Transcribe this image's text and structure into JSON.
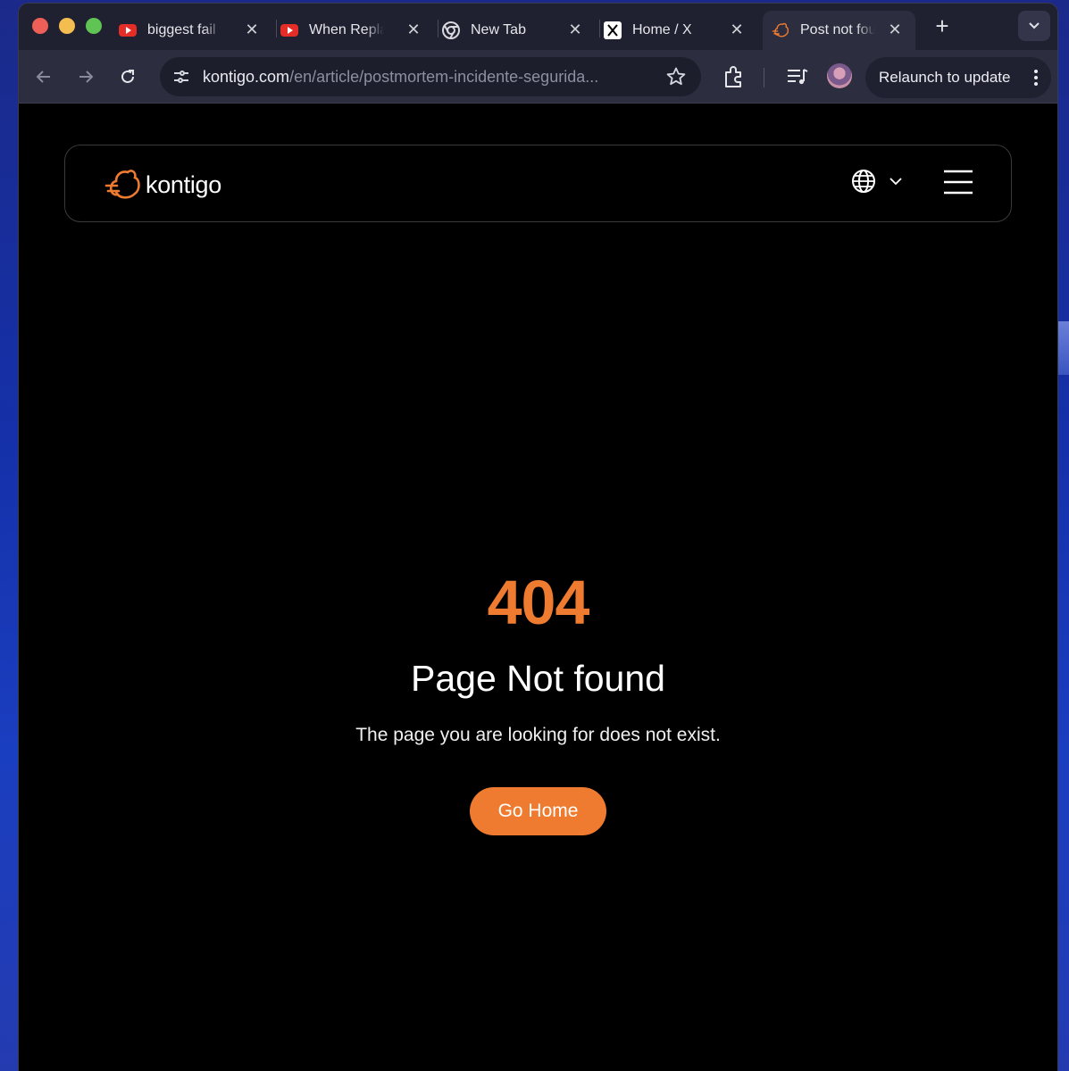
{
  "browser": {
    "tabs": [
      {
        "title": "biggest fail",
        "icon": "youtube-icon"
      },
      {
        "title": "When Repla",
        "icon": "youtube-icon"
      },
      {
        "title": "New Tab",
        "icon": "chrome-icon"
      },
      {
        "title": "Home / X",
        "icon": "x-icon"
      },
      {
        "title": "Post not fou",
        "icon": "kontigo-icon",
        "active": true
      }
    ],
    "url_host": "kontigo.com",
    "url_path": "/en/article/postmortem-incidente-segurida...",
    "relaunch_label": "Relaunch to update"
  },
  "site": {
    "logo_text": "kontigo",
    "brand_color": "#ee7b30"
  },
  "error": {
    "code": "404",
    "title": "Page Not found",
    "description": "The page you are looking for does not exist.",
    "button_label": "Go Home"
  }
}
